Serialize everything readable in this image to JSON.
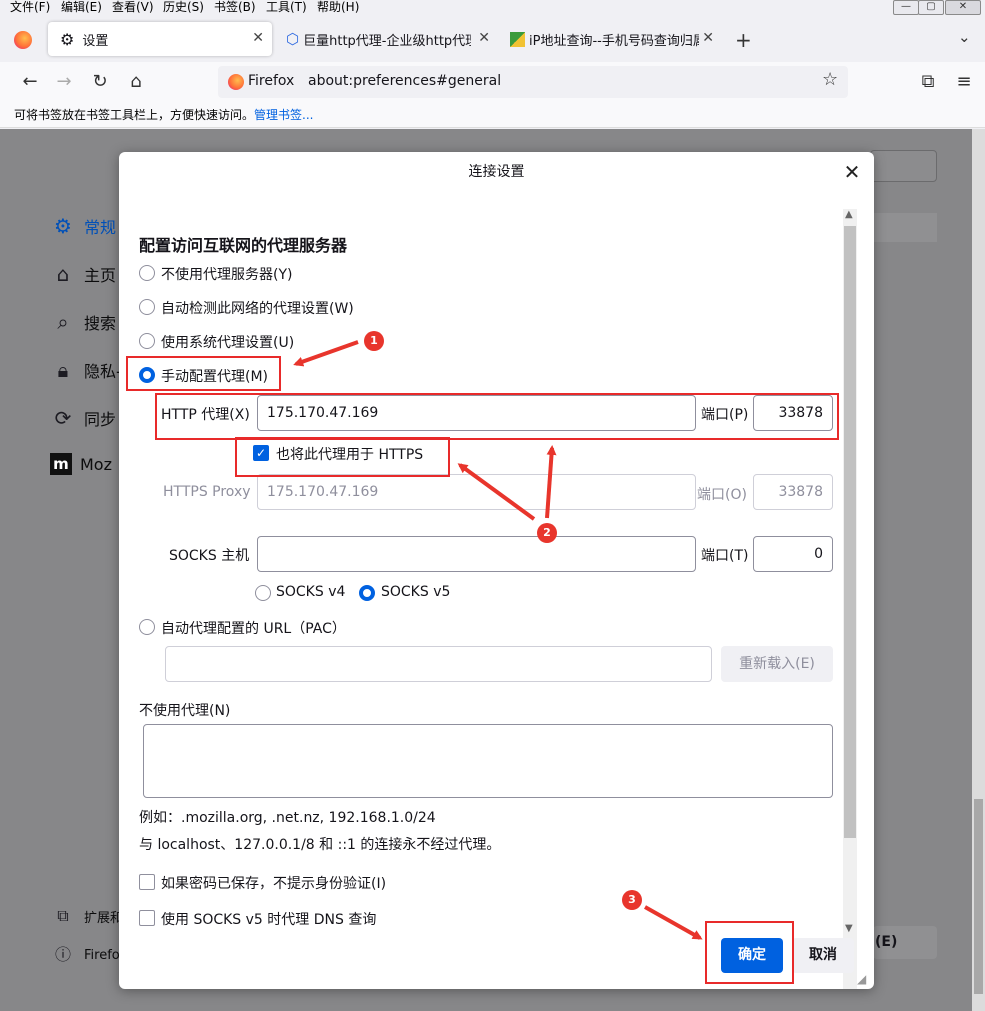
{
  "menu": [
    "文件(F)",
    "编辑(E)",
    "查看(V)",
    "历史(S)",
    "书签(B)",
    "工具(T)",
    "帮助(H)"
  ],
  "tabs": [
    {
      "title": "设置",
      "active": true
    },
    {
      "title": "巨量http代理-企业级http代理"
    },
    {
      "title": "iP地址查询--手机号码查询归属"
    }
  ],
  "nav": {
    "identity": "Firefox",
    "url": "about:preferences#general"
  },
  "bookmarks_bar": {
    "text": "可将书签放在书签工具栏上，方便快速访问。",
    "link": "管理书签..."
  },
  "sidebar": {
    "items": [
      "常规",
      "主页",
      "搜索",
      "隐私-",
      "同步",
      "Moz"
    ],
    "bottom": [
      "扩展和",
      "Firefo"
    ],
    "right_fragment": "(E)"
  },
  "dialog": {
    "title": "连接设置",
    "heading": "配置访问互联网的代理服务器",
    "options": {
      "no_proxy": "不使用代理服务器(Y)",
      "auto_detect": "自动检测此网络的代理设置(W)",
      "system": "使用系统代理设置(U)",
      "manual": "手动配置代理(M)"
    },
    "http": {
      "label": "HTTP 代理(X)",
      "value": "175.170.47.169",
      "port_label": "端口(P)",
      "port": "33878"
    },
    "also_https": "也将此代理用于 HTTPS",
    "https": {
      "label": "HTTPS Proxy",
      "value": "175.170.47.169",
      "port_label": "端口(O)",
      "port": "33878"
    },
    "socks": {
      "label": "SOCKS 主机",
      "value": "",
      "port_label": "端口(T)",
      "port": "0",
      "v4": "SOCKS v4",
      "v5": "SOCKS v5"
    },
    "pac": {
      "label": "自动代理配置的 URL（PAC）",
      "value": "",
      "reload": "重新载入(E)"
    },
    "no_proxy_for": {
      "label": "不使用代理(N)",
      "value": ""
    },
    "example": "例如：.mozilla.org, .net.nz, 192.168.1.0/24",
    "localhost_note": "与 localhost、127.0.0.1/8 和 ::1 的连接永不经过代理。",
    "no_auth_prompt": "如果密码已保存，不提示身份验证(I)",
    "socks_dns": "使用 SOCKS v5 时代理 DNS 查询",
    "ok": "确定",
    "cancel": "取消"
  },
  "annotations": [
    "1",
    "2",
    "3"
  ],
  "colors": {
    "accent": "#0061e0",
    "annotation": "#e82a2a"
  }
}
